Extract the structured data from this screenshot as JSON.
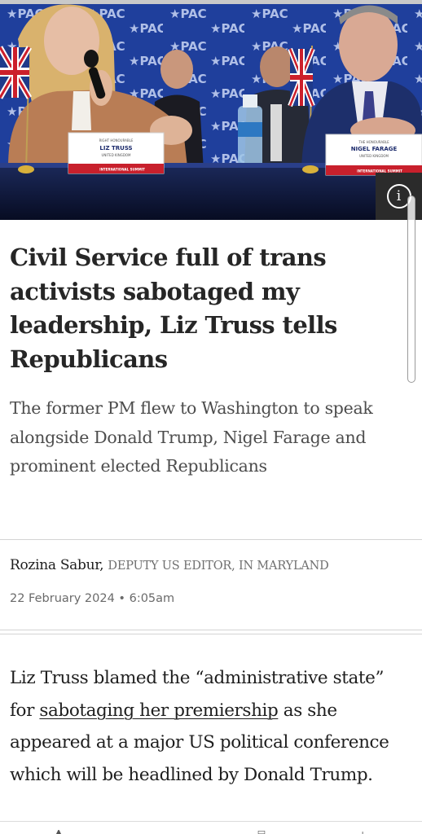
{
  "hero": {
    "placards": {
      "left": {
        "honorific": "RIGHT HONOURABLE",
        "name": "LIZ TRUSS",
        "country": "UNITED KINGDOM",
        "event": "INTERNATIONAL SUMMIT"
      },
      "right": {
        "honorific": "THE HONOURABLE",
        "name": "NIGEL FARAGE",
        "country": "UNITED KINGDOM",
        "event": "INTERNATIONAL SUMMIT"
      }
    },
    "backdrop_logo": "CPAC",
    "info_icon_glyph": "i"
  },
  "article": {
    "headline": "Civil Service full of trans activists sabotaged my leadership, Liz Truss tells Republicans",
    "standfirst": "The former PM flew to Washington to speak alongside Donald Trump, Nigel Farage and prominent elected Republicans",
    "author": "Rozina Sabur,",
    "author_role": "DEPUTY US EDITOR, IN MARYLAND",
    "date": "22 February 2024 • 6:05am",
    "body_before_link": "Liz Truss blamed the “administrative state” for ",
    "body_link": "sabotaging her premiership",
    "body_after_link": " as she appeared at a major US political conference which will be headlined by Donald Trump."
  },
  "colors": {
    "backdrop_blue": "#1f3f9c",
    "table_navy": "#0f1a3c",
    "headline_text": "#262626",
    "standfirst_text": "#4d4d4d",
    "meta_grey": "#707070"
  }
}
